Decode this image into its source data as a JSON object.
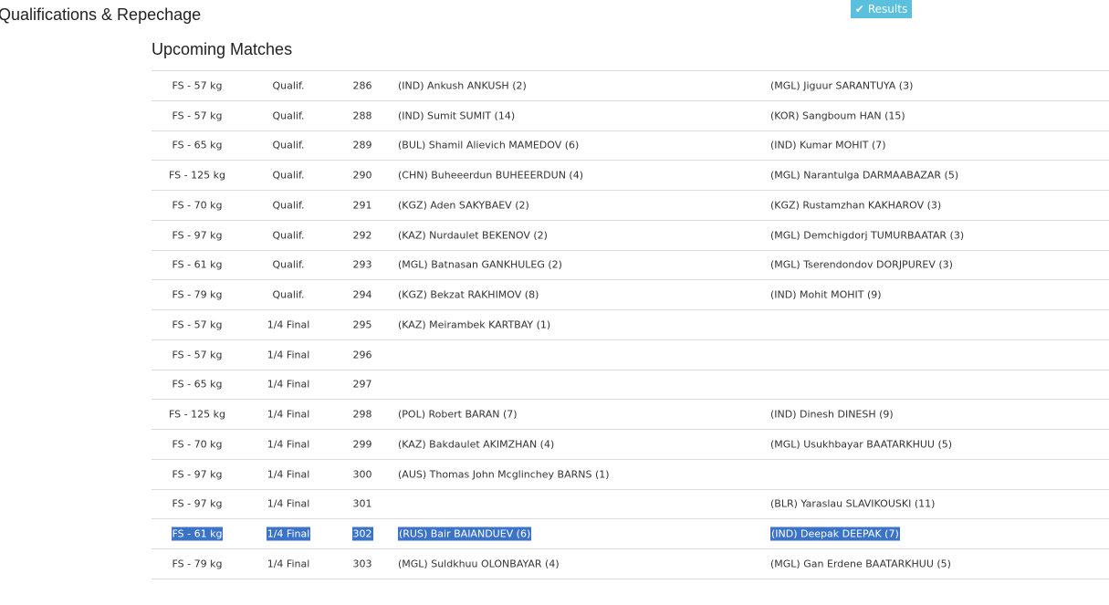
{
  "page": {
    "title": "Qualifications & Repechage"
  },
  "results_button": {
    "label": "Results",
    "icon": "check-icon"
  },
  "section": {
    "title": "Upcoming Matches"
  },
  "colors": {
    "results_button_bg": "#5bc0de",
    "selection_bg": "#3b73c6",
    "row_border": "#dddddd"
  },
  "matches": [
    {
      "category": "FS - 57 kg",
      "round": "Qualif.",
      "number": "286",
      "red": "(IND) Ankush ANKUSH (2)",
      "blue": "(MGL) Jiguur SARANTUYA (3)"
    },
    {
      "category": "FS - 57 kg",
      "round": "Qualif.",
      "number": "288",
      "red": "(IND) Sumit SUMIT (14)",
      "blue": "(KOR) Sangboum HAN (15)"
    },
    {
      "category": "FS - 65 kg",
      "round": "Qualif.",
      "number": "289",
      "red": "(BUL) Shamil Alievich MAMEDOV (6)",
      "blue": "(IND) Kumar MOHIT (7)"
    },
    {
      "category": "FS - 125 kg",
      "round": "Qualif.",
      "number": "290",
      "red": "(CHN) Buheeerdun BUHEEERDUN (4)",
      "blue": "(MGL) Narantulga DARMAABAZAR (5)"
    },
    {
      "category": "FS - 70 kg",
      "round": "Qualif.",
      "number": "291",
      "red": "(KGZ) Aden SAKYBAEV (2)",
      "blue": "(KGZ) Rustamzhan KAKHAROV (3)"
    },
    {
      "category": "FS - 97 kg",
      "round": "Qualif.",
      "number": "292",
      "red": "(KAZ) Nurdaulet BEKENOV (2)",
      "blue": "(MGL) Demchigdorj TUMURBAATAR (3)"
    },
    {
      "category": "FS - 61 kg",
      "round": "Qualif.",
      "number": "293",
      "red": "(MGL) Batnasan GANKHULEG (2)",
      "blue": "(MGL) Tserendondov DORJPUREV (3)"
    },
    {
      "category": "FS - 79 kg",
      "round": "Qualif.",
      "number": "294",
      "red": "(KGZ) Bekzat RAKHIMOV (8)",
      "blue": "(IND) Mohit MOHIT (9)"
    },
    {
      "category": "FS - 57 kg",
      "round": "1/4 Final",
      "number": "295",
      "red": "(KAZ) Meirambek KARTBAY (1)",
      "blue": ""
    },
    {
      "category": "FS - 57 kg",
      "round": "1/4 Final",
      "number": "296",
      "red": "",
      "blue": ""
    },
    {
      "category": "FS - 65 kg",
      "round": "1/4 Final",
      "number": "297",
      "red": "",
      "blue": ""
    },
    {
      "category": "FS - 125 kg",
      "round": "1/4 Final",
      "number": "298",
      "red": "(POL) Robert BARAN (7)",
      "blue": "(IND) Dinesh DINESH (9)"
    },
    {
      "category": "FS - 70 kg",
      "round": "1/4 Final",
      "number": "299",
      "red": "(KAZ) Bakdaulet AKIMZHAN (4)",
      "blue": "(MGL) Usukhbayar BAATARKHUU (5)"
    },
    {
      "category": "FS - 97 kg",
      "round": "1/4 Final",
      "number": "300",
      "red": "(AUS) Thomas John Mcglinchey BARNS (1)",
      "blue": ""
    },
    {
      "category": "FS - 97 kg",
      "round": "1/4 Final",
      "number": "301",
      "red": "",
      "blue": "(BLR) Yaraslau SLAVIKOUSKI (11)"
    },
    {
      "category": "FS - 61 kg",
      "round": "1/4 Final",
      "number": "302",
      "red": "(RUS) Bair BAIANDUEV (6)",
      "blue": "(IND) Deepak DEEPAK (7)",
      "selected": true
    },
    {
      "category": "FS - 79 kg",
      "round": "1/4 Final",
      "number": "303",
      "red": "(MGL) Suldkhuu OLONBAYAR (4)",
      "blue": "(MGL) Gan Erdene BAATARKHUU (5)"
    }
  ]
}
